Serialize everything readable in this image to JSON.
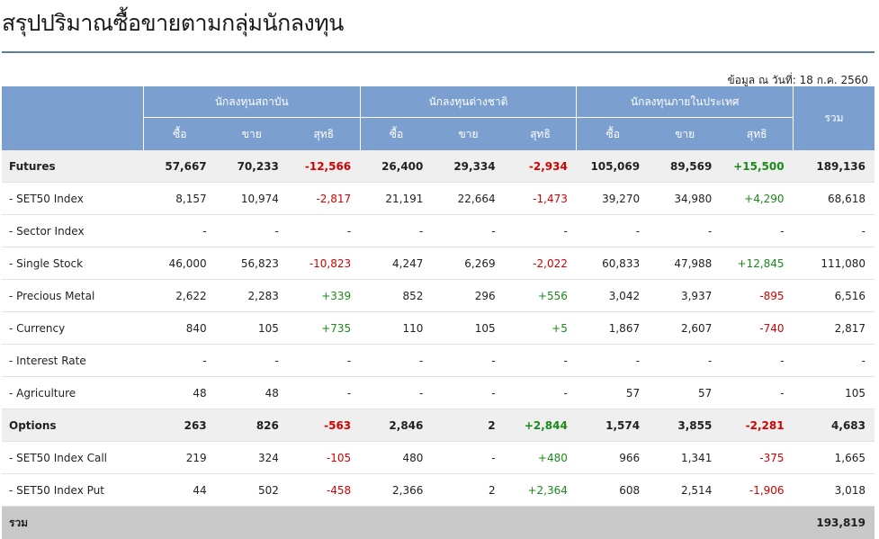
{
  "page": {
    "title": "สรุปปริมาณซื้อขายตามกลุ่มนักลงทุน",
    "as_of": "ข้อมูล ณ วันที่: 18 ก.ค. 2560"
  },
  "colors": {
    "header_bg": "#7b9fcf",
    "negative": "#d50000",
    "positive": "#1a8a1a",
    "category_row_bg": "#efefef",
    "total_row_bg": "#c9c9c9"
  },
  "table": {
    "groups": [
      "นักลงทุนสถาบัน",
      "นักลงทุนต่างชาติ",
      "นักลงทุนภายในประเทศ"
    ],
    "subheaders": [
      "ซื้อ",
      "ขาย",
      "สุทธิ"
    ],
    "total_header": "รวม",
    "rows": [
      {
        "type": "cat",
        "label": "Futures",
        "vals": [
          "57,667",
          "70,233",
          "-12,566",
          "26,400",
          "29,334",
          "-2,934",
          "105,069",
          "89,569",
          "+15,500",
          "189,136"
        ]
      },
      {
        "type": "sub",
        "label": "- SET50 Index",
        "vals": [
          "8,157",
          "10,974",
          "-2,817",
          "21,191",
          "22,664",
          "-1,473",
          "39,270",
          "34,980",
          "+4,290",
          "68,618"
        ]
      },
      {
        "type": "sub",
        "label": "- Sector Index",
        "vals": [
          "-",
          "-",
          "-",
          "-",
          "-",
          "-",
          "-",
          "-",
          "-",
          "-"
        ]
      },
      {
        "type": "sub",
        "label": "- Single Stock",
        "vals": [
          "46,000",
          "56,823",
          "-10,823",
          "4,247",
          "6,269",
          "-2,022",
          "60,833",
          "47,988",
          "+12,845",
          "111,080"
        ]
      },
      {
        "type": "sub",
        "label": "- Precious Metal",
        "vals": [
          "2,622",
          "2,283",
          "+339",
          "852",
          "296",
          "+556",
          "3,042",
          "3,937",
          "-895",
          "6,516"
        ]
      },
      {
        "type": "sub",
        "label": "- Currency",
        "vals": [
          "840",
          "105",
          "+735",
          "110",
          "105",
          "+5",
          "1,867",
          "2,607",
          "-740",
          "2,817"
        ]
      },
      {
        "type": "sub",
        "label": "- Interest Rate",
        "vals": [
          "-",
          "-",
          "-",
          "-",
          "-",
          "-",
          "-",
          "-",
          "-",
          "-"
        ]
      },
      {
        "type": "sub",
        "label": "- Agriculture",
        "vals": [
          "48",
          "48",
          "-",
          "-",
          "-",
          "-",
          "57",
          "57",
          "-",
          "105"
        ]
      },
      {
        "type": "cat",
        "label": "Options",
        "vals": [
          "263",
          "826",
          "-563",
          "2,846",
          "2",
          "+2,844",
          "1,574",
          "3,855",
          "-2,281",
          "4,683"
        ]
      },
      {
        "type": "sub",
        "label": "- SET50 Index Call",
        "vals": [
          "219",
          "324",
          "-105",
          "480",
          "-",
          "+480",
          "966",
          "1,341",
          "-375",
          "1,665"
        ]
      },
      {
        "type": "sub",
        "label": "- SET50 Index Put",
        "vals": [
          "44",
          "502",
          "-458",
          "2,366",
          "2",
          "+2,364",
          "608",
          "2,514",
          "-1,906",
          "3,018"
        ]
      }
    ],
    "grand_total": {
      "label": "รวม",
      "value": "193,819"
    }
  }
}
